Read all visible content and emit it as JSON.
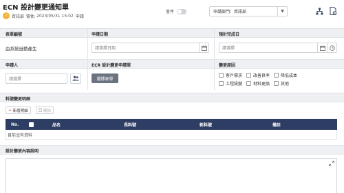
{
  "header": {
    "title": "ECN 設計變更通知單",
    "applicant_dept": "資訊部",
    "applicant_name": "雲佑",
    "timestamp": "2023/05/31 15:02",
    "status": "申請",
    "toggle_label": "會件",
    "dept_select_value": "申請部門：資訊部",
    "icons": [
      "org-chart-icon",
      "document-settings-icon"
    ]
  },
  "form": {
    "form_no_label": "表單編號",
    "form_no_value": "由系統自動產生",
    "apply_date_label": "申請日期",
    "apply_date_placeholder": "請選擇日期",
    "due_date_label": "預計完成日",
    "due_date_placeholder": "請選擇",
    "applicant_label": "申請人",
    "applicant_placeholder": "請選擇",
    "ecr_label": "ECR 設計變更申請單",
    "ecr_button": "選擇表單",
    "reason_label": "變更原因",
    "reasons": [
      "客戶需求",
      "改善良率",
      "降低成本",
      "工程設變",
      "材料更換",
      "其他"
    ]
  },
  "material": {
    "section_label": "料號變更明細",
    "add_button": "新增明細",
    "delete_button": "刪除",
    "columns": [
      "No.",
      "",
      "品名",
      "長料號",
      "新料號",
      "備註"
    ],
    "empty_text": "目前沒有資料"
  },
  "description": {
    "section_label": "設計變更內容說明",
    "content": ""
  },
  "colors": {
    "table_header": "#2d3d63",
    "band": "#eef0f3",
    "primary_button": "#6b7280",
    "avatar": "#f1b33a",
    "add_icon": "#e05a2b"
  }
}
